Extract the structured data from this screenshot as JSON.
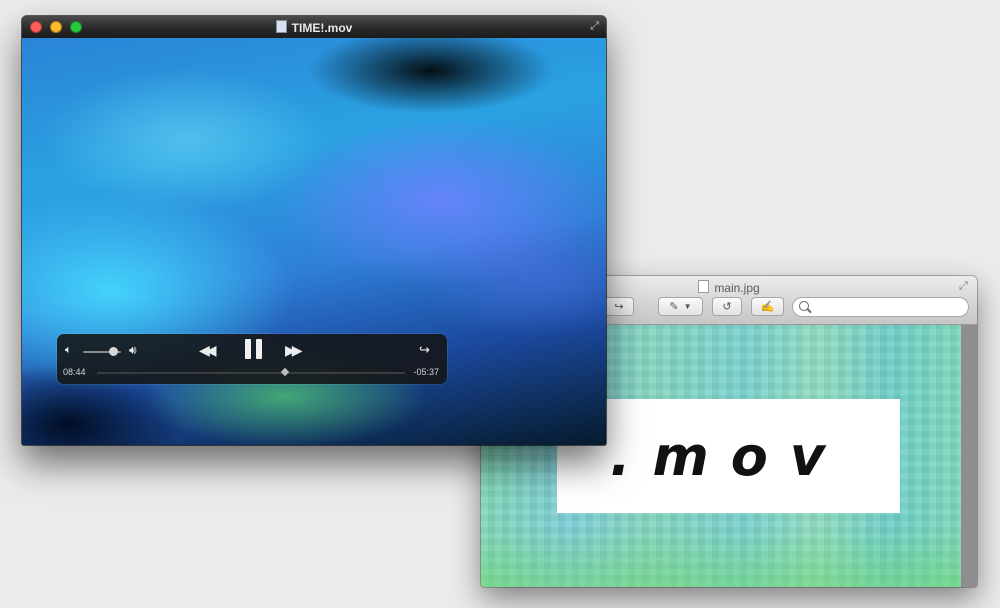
{
  "desktop": {
    "background": "#ebebeb"
  },
  "quicktime": {
    "title": "TIME!.mov",
    "traffic_lights": [
      "#ff5f57",
      "#ffbd2e",
      "#28c940"
    ],
    "controls": {
      "volume_low_icon": "speaker-low-icon",
      "volume_level": 0.8,
      "volume_high_icon": "speaker-high-icon",
      "rewind_icon": "rewind-icon",
      "pause_icon": "pause-icon",
      "fast_forward_icon": "fast-forward-icon",
      "share_icon": "share-icon",
      "elapsed": "08:44",
      "remaining": "-05:37",
      "progress": 0.61
    }
  },
  "preview": {
    "title": "main.jpg",
    "toolbar": {
      "share_icon": "share-icon",
      "markup_icon": "markup-pen-icon",
      "rotate_icon": "rotate-icon",
      "edit_icon": "edit-icon",
      "search_placeholder": ""
    },
    "image_text": ".mov"
  }
}
